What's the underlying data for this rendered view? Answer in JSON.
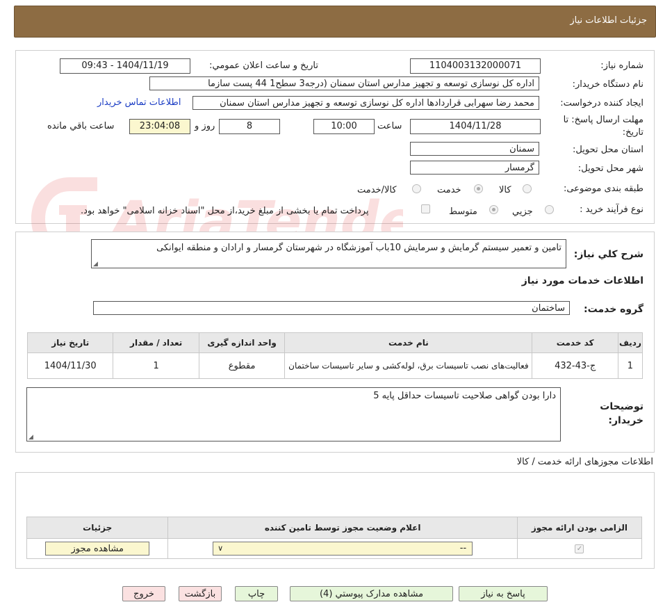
{
  "header": {
    "title": "جزئیات اطلاعات نیاز"
  },
  "details": {
    "need_number_label": "شماره نیاز:",
    "need_number": "1104003132000071",
    "announce_label": "تاریخ و ساعت اعلان عمومي:",
    "announce_value": "1404/11/19 - 09:43",
    "buyer_org_label": "نام دستگاه خریدار:",
    "buyer_org": "اداره کل نوسازی   توسعه و تجهیز مدارس استان سمنان (درجه3  سطح1  44 پست سازما",
    "creator_label": "ایجاد کننده درخواست:",
    "creator": "محمد رضا سهرابی قراردادها اداره کل نوسازی   توسعه و تجهیز مدارس استان سمنان",
    "contact_link": "اطلاعات تماس خریدار",
    "deadline_label_1": "مهلت ارسال پاسخ: تا",
    "deadline_label_2": "تاریخ:",
    "deadline_date": "1404/11/28",
    "time_label": "ساعت",
    "deadline_time": "10:00",
    "days_value": "8",
    "days_label": "روز و",
    "remaining_value": "23:04:08",
    "remaining_label": "ساعت باقي مانده",
    "province_label": "استان محل تحویل:",
    "province": "سمنان",
    "city_label": "شهر محل تحویل:",
    "city": "گرمسار",
    "category_label": "طبقه بندی موضوعی:",
    "category_options": [
      "کالا",
      "خدمت",
      "کالا/خدمت"
    ],
    "category_selected": "خدمت",
    "process_label": "نوع فرآیند خرید :",
    "process_options": [
      "جزیي",
      "متوسط"
    ],
    "process_selected": "متوسط",
    "payment_note": "پرداخت تمام یا بخشی از مبلغ خرید،از محل \"اسناد خزانه اسلامی\" خواهد بود.",
    "watermark": "AriaTender.neT"
  },
  "summary": {
    "label": "شرح کلي نیاز:",
    "value": "تامین و تعمیر سیستم گرمایش و سرمایش  10باب آموزشگاه در شهرستان گرمسار و ارادان و منطقه ایوانکی"
  },
  "services": {
    "section_title": "اطلاعات خدمات مورد نیاز",
    "group_label": "گروه خدمت:",
    "group_value": "ساختمان",
    "columns": [
      "ردیف",
      "کد خدمت",
      "نام خدمت",
      "واحد اندازه گیری",
      "تعداد / مقدار",
      "تاریخ نیاز"
    ],
    "rows": [
      [
        "1",
        "ج-43-432",
        "فعالیت‌های نصب تاسیسات برق، لوله‌کشی و سایر تاسیسات ساختمان",
        "مقطوع",
        "1",
        "1404/11/30"
      ]
    ]
  },
  "buyer_notes": {
    "label_1": "توضیحات",
    "label_2": "خریدار:",
    "value": "دارا بودن گواهی صلاحیت تاسیسات حداقل پایه 5"
  },
  "permits": {
    "title": "اطلاعات مجوزهای ارائه خدمت / کالا",
    "columns": [
      "الزامی بودن ارائه مجوز",
      "اعلام وضعیت مجوز توسط تامین کننده",
      "جزئیات"
    ],
    "select_value": "--",
    "view_button": "مشاهده مجوز"
  },
  "footer": {
    "reply": "پاسخ به نیاز",
    "attachments": "مشاهده مدارک پیوستي (4)",
    "print": "چاپ",
    "back": "بازگشت",
    "exit": "خروج"
  },
  "colors": {
    "header_bg": "#8d6c43",
    "green_button": "#e6f6da",
    "pink_button": "#fbe1e1",
    "remaining_bg": "#fbf7cf"
  }
}
